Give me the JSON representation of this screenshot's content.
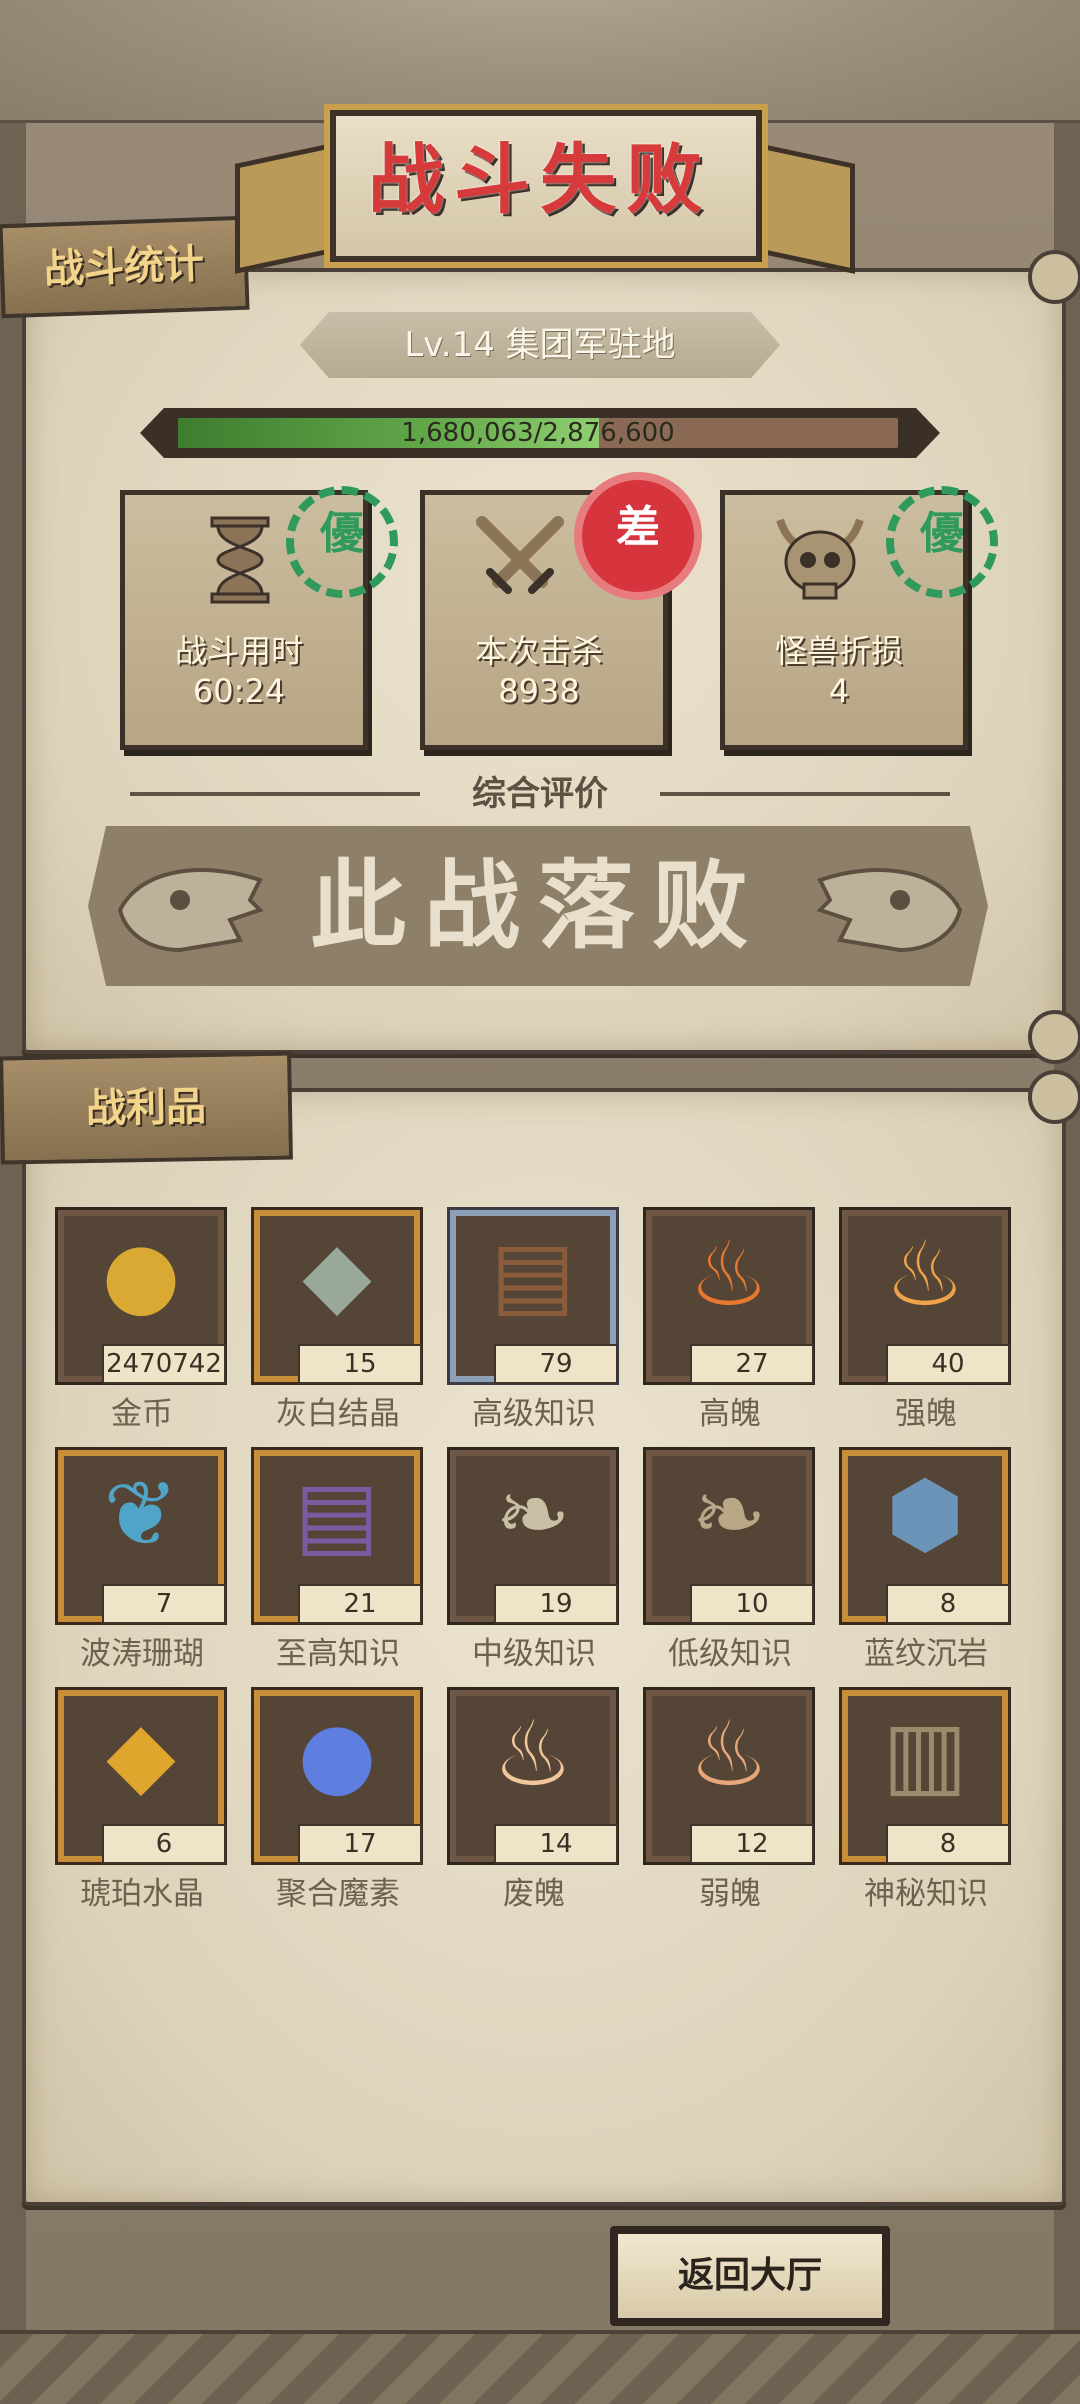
{
  "result_title": "战斗失败",
  "stats_section": {
    "tab_label": "战斗统计",
    "location": "Lv.14 集团军驻地",
    "progress": {
      "text": "1,680,063/2,876,600",
      "current": 1680063,
      "total": 2876600
    },
    "cards": [
      {
        "label": "战斗用时",
        "value": "60:24",
        "icon": "hourglass-icon",
        "stamp": "green"
      },
      {
        "label": "本次击杀",
        "value": "8938",
        "icon": "crossed-swords-icon",
        "stamp": "red"
      },
      {
        "label": "怪兽折损",
        "value": "4",
        "icon": "horned-skull-icon",
        "stamp": "green"
      }
    ],
    "evaluation_label": "综合评价",
    "verdict": "此战落败"
  },
  "loot_section": {
    "tab_label": "战利品",
    "items": [
      {
        "name": "金币",
        "qty": "2470742",
        "icon": "gold-coin-icon",
        "frame": "brown"
      },
      {
        "name": "灰白结晶",
        "qty": "15",
        "icon": "gray-crystal-icon",
        "frame": "gold"
      },
      {
        "name": "高级知识",
        "qty": "79",
        "icon": "advanced-book-icon",
        "frame": "blue"
      },
      {
        "name": "高魄",
        "qty": "27",
        "icon": "orange-flame-icon",
        "frame": "brown"
      },
      {
        "name": "强魄",
        "qty": "40",
        "icon": "flame-icon",
        "frame": "brown"
      },
      {
        "name": "波涛珊瑚",
        "qty": "7",
        "icon": "coral-icon",
        "frame": "gold"
      },
      {
        "name": "至高知识",
        "qty": "21",
        "icon": "supreme-book-icon",
        "frame": "gold"
      },
      {
        "name": "中级知识",
        "qty": "19",
        "icon": "scroll-icon",
        "frame": "brown"
      },
      {
        "name": "低级知识",
        "qty": "10",
        "icon": "small-scroll-icon",
        "frame": "brown"
      },
      {
        "name": "蓝纹沉岩",
        "qty": "8",
        "icon": "blue-rock-icon",
        "frame": "gold"
      },
      {
        "name": "琥珀水晶",
        "qty": "6",
        "icon": "amber-crystal-icon",
        "frame": "gold"
      },
      {
        "name": "聚合魔素",
        "qty": "17",
        "icon": "mana-orb-icon",
        "frame": "gold"
      },
      {
        "name": "废魄",
        "qty": "14",
        "icon": "pale-flame-icon",
        "frame": "brown"
      },
      {
        "name": "弱魄",
        "qty": "12",
        "icon": "weak-flame-icon",
        "frame": "brown"
      },
      {
        "name": "神秘知识",
        "qty": "8",
        "icon": "stone-tablet-icon",
        "frame": "gold"
      }
    ]
  },
  "return_button_label": "返回大厅",
  "colors": {
    "result_red": "#d63a3a",
    "tab_gold": "#f2d48a",
    "progress_green": "#62a84a",
    "stamp_green": "#2f9a5c",
    "stamp_red": "#d6353d"
  }
}
